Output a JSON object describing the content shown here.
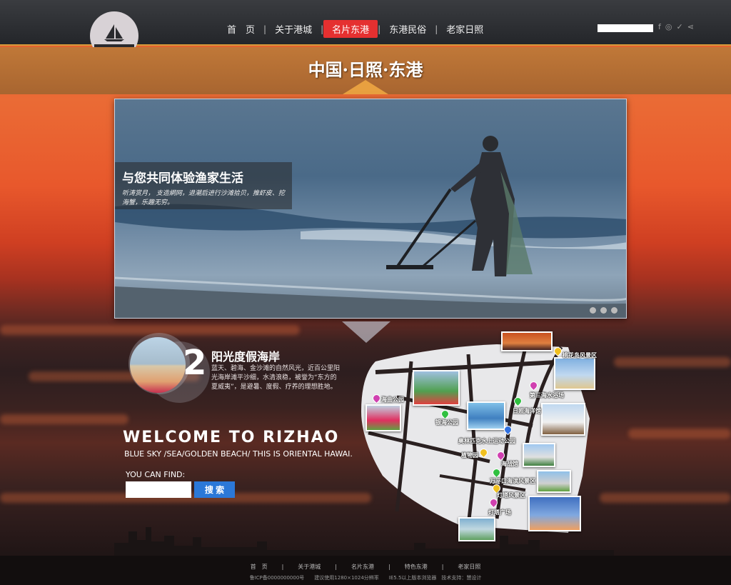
{
  "nav": {
    "items": [
      "首　页",
      "关于港城",
      "名片东港",
      "东港民俗",
      "老家日照"
    ],
    "active_index": 2,
    "separator": "|"
  },
  "header": {
    "social_icons": [
      "facebook-icon",
      "dribbble-icon",
      "twitter-icon",
      "share-icon"
    ]
  },
  "banner": {
    "title": "中国·日照·东港"
  },
  "hero": {
    "title": "与您共同体验渔家生活",
    "subtitle": "听涛赏月， 支造網网，退潮后进行沙滩拾贝，推虾皮、挖海蟹，乐趣无穷。",
    "slides": 3,
    "active_slide": 0
  },
  "section2": {
    "number": "2",
    "title": "阳光度假海岸",
    "text": "蓝天、碧海、金沙滩的自然风光，近百公里阳光海岸滩平沙细，水清浪稳，被誉为“东方的夏威夷”，是避暑、度假、疗养的理想胜地。"
  },
  "welcome": {
    "title": "WELCOME TO RIZHAO",
    "subtitle": "BLUE SKY /SEA/GOLDEN BEACH/ THIS IS ORIENTAL HAWAI.",
    "find_label": "YOU CAN FIND:",
    "search_value": "",
    "search_button": "搜 索"
  },
  "map": {
    "locations": [
      {
        "name": "桃花岛风景区",
        "pin": "#f0c020"
      },
      {
        "name": "海曲公园",
        "pin": "#d040b0"
      },
      {
        "name": "第三海水浴场",
        "pin": "#d040b0"
      },
      {
        "name": "银海公园",
        "pin": "#30c040"
      },
      {
        "name": "日照海洋馆",
        "pin": "#30c040"
      },
      {
        "name": "奥林匹克水上运动公园",
        "pin": "#3070e0"
      },
      {
        "name": "植物园",
        "pin": "#f0c020"
      },
      {
        "name": "海战馆",
        "pin": "#d040b0"
      },
      {
        "name": "万平口海滨风景区",
        "pin": "#30c040"
      },
      {
        "name": "灯塔风景区",
        "pin": "#f0c020"
      },
      {
        "name": "灯塔广场",
        "pin": "#d040b0"
      }
    ]
  },
  "footer": {
    "nav": [
      "首　页",
      "关于港城",
      "名片东港",
      "特色东港",
      "老家日照"
    ],
    "note": "鲁ICP备0000000000号　　建议使用1280×1024分辨率　　IE5.5以上版本浏览器　技术支持：慧设计"
  }
}
